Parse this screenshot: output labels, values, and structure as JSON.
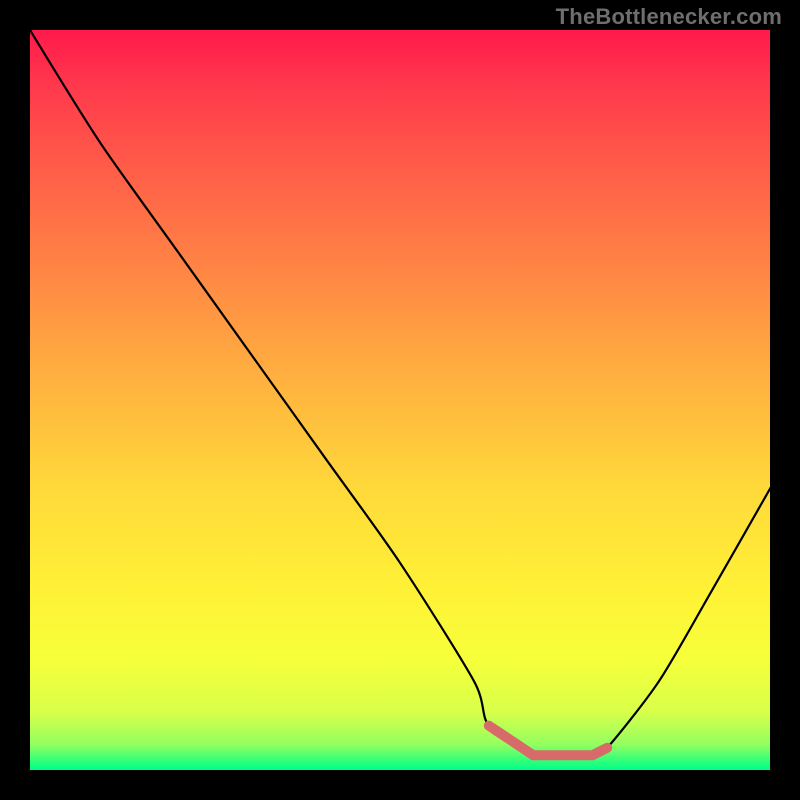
{
  "watermark": "TheBottlenecker.com",
  "chart_data": {
    "type": "line",
    "title": "",
    "xlabel": "",
    "ylabel": "",
    "xlim": [
      0,
      100
    ],
    "ylim": [
      0,
      100
    ],
    "x": [
      0,
      3,
      10,
      20,
      30,
      40,
      50,
      60,
      62,
      68,
      76,
      78,
      85,
      92,
      100
    ],
    "values": [
      100,
      95,
      84,
      70,
      56,
      42,
      28,
      12,
      6,
      2,
      2,
      3,
      12,
      24,
      38
    ],
    "highlight_segment": {
      "x_from": 62,
      "x_to": 78
    },
    "colors": {
      "curve": "#000000",
      "highlight": "#d96a6a",
      "gradient_top": "#ff1a4b",
      "gradient_bottom": "#00ff88"
    }
  }
}
